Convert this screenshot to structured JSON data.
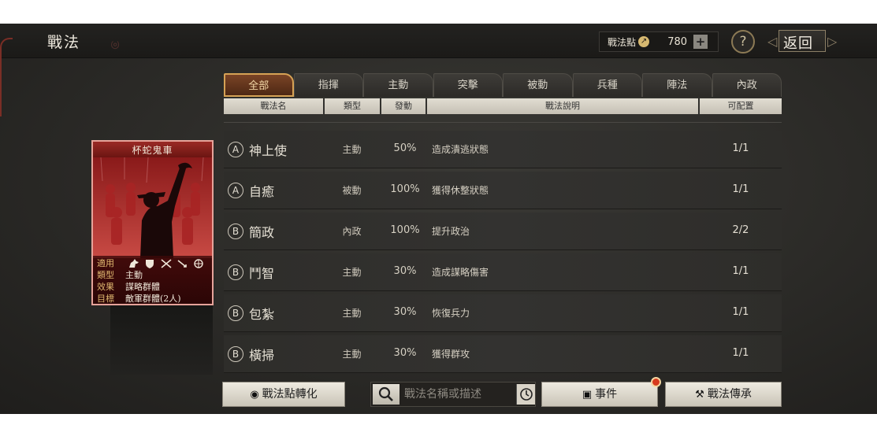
{
  "header": {
    "title": "戰法",
    "points_label": "戰法點",
    "points_value": "780",
    "add_symbol": "+",
    "help_symbol": "?",
    "back_label": "返回"
  },
  "tabs": [
    {
      "label": "全部",
      "active": true
    },
    {
      "label": "指揮",
      "active": false
    },
    {
      "label": "主動",
      "active": false
    },
    {
      "label": "突擊",
      "active": false
    },
    {
      "label": "被動",
      "active": false
    },
    {
      "label": "兵種",
      "active": false
    },
    {
      "label": "陣法",
      "active": false
    },
    {
      "label": "內政",
      "active": false
    }
  ],
  "columns": {
    "name": "戰法名",
    "type": "類型",
    "rate": "發動",
    "desc": "戰法說明",
    "slots": "可配置"
  },
  "rows": [
    {
      "grade": "A",
      "name": "神上使",
      "type": "主動",
      "rate": "50%",
      "desc": "造成潰逃狀態",
      "slots": "1/1"
    },
    {
      "grade": "A",
      "name": "自癒",
      "type": "被動",
      "rate": "100%",
      "desc": "獲得休整狀態",
      "slots": "1/1"
    },
    {
      "grade": "B",
      "name": "簡政",
      "type": "內政",
      "rate": "100%",
      "desc": "提升政治",
      "slots": "2/2"
    },
    {
      "grade": "B",
      "name": "鬥智",
      "type": "主動",
      "rate": "30%",
      "desc": "造成謀略傷害",
      "slots": "1/1"
    },
    {
      "grade": "B",
      "name": "包紮",
      "type": "主動",
      "rate": "30%",
      "desc": "恢復兵力",
      "slots": "1/1"
    },
    {
      "grade": "B",
      "name": "橫掃",
      "type": "主動",
      "rate": "30%",
      "desc": "獲得群攻",
      "slots": "1/1"
    }
  ],
  "card": {
    "name": "杯蛇鬼車",
    "apply_label": "適用",
    "type_label": "類型",
    "type_value": "主動",
    "effect_label": "效果",
    "effect_value": "謀略群體",
    "target_label": "目標",
    "target_value": "敵軍群體(2人)",
    "troop_icons": [
      "cavalry-icon",
      "shield-icon",
      "crossed-spears-icon",
      "bow-icon",
      "wheel-icon"
    ]
  },
  "bottom": {
    "convert_label": "戰法點轉化",
    "search_placeholder": "戰法名稱或描述",
    "event_label": "事件",
    "inherit_label": "戰法傳承"
  },
  "colors": {
    "active_tab": "#7a4426",
    "card_border": "#e6a39a",
    "badge": "#d63a1e"
  }
}
